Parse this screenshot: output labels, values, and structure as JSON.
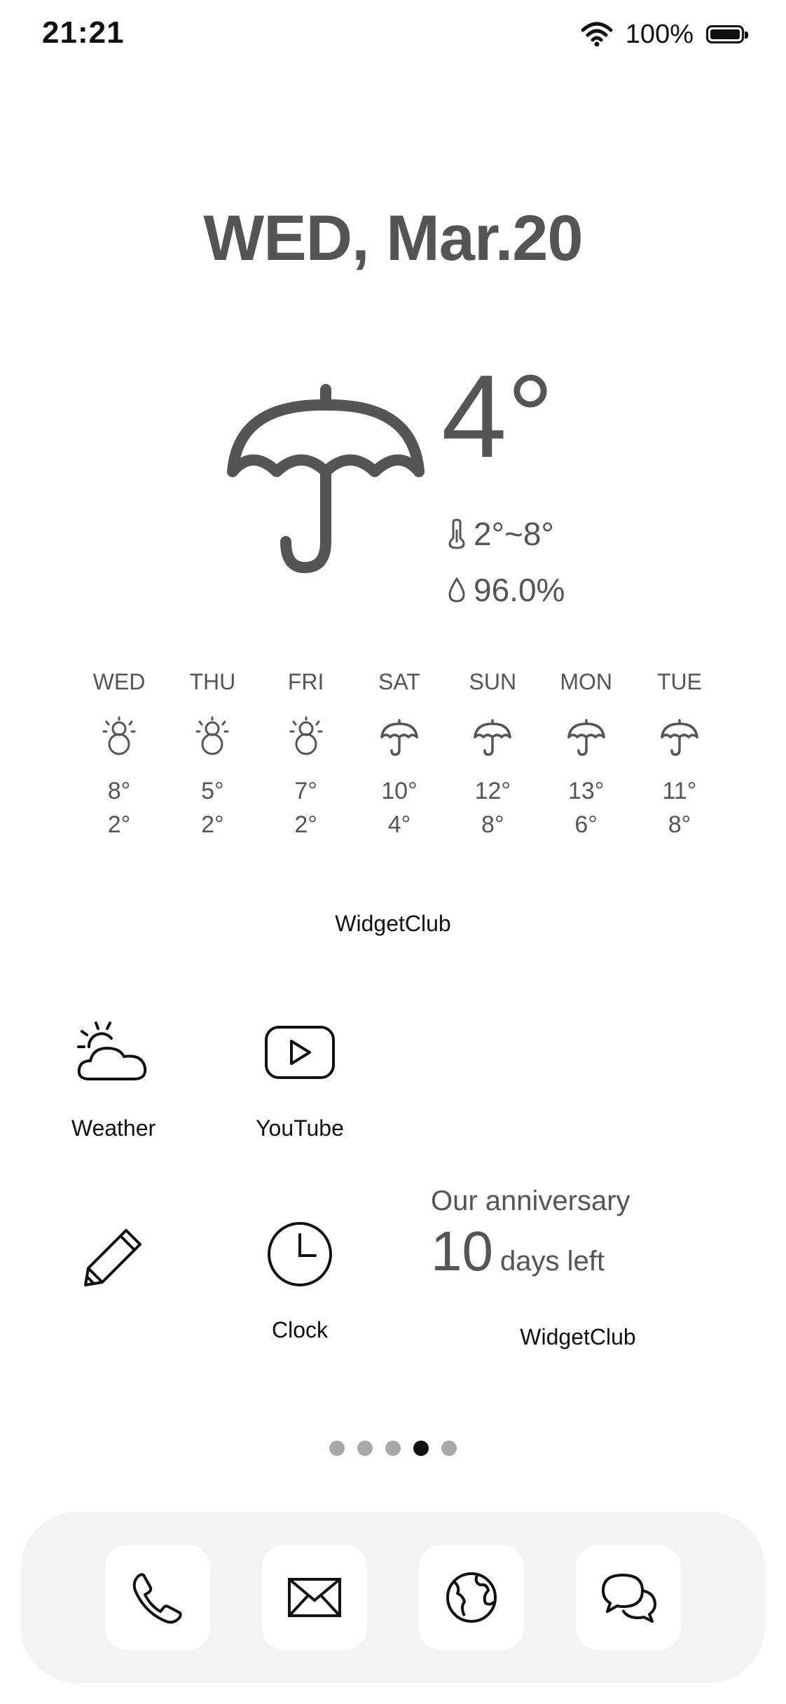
{
  "status_bar": {
    "time": "21:21",
    "battery": "100%",
    "battery_level": 1.0
  },
  "weather_widget": {
    "date": "WED, Mar.20",
    "current_icon": "umbrella-icon",
    "temperature": "4°",
    "min_max": "2°~8°",
    "humidity": "96.0%",
    "forecast": [
      {
        "day": "WED",
        "icon": "snowman-icon",
        "high": "8°",
        "low": "2°"
      },
      {
        "day": "THU",
        "icon": "snowman-icon",
        "high": "5°",
        "low": "2°"
      },
      {
        "day": "FRI",
        "icon": "snowman-icon",
        "high": "7°",
        "low": "2°"
      },
      {
        "day": "SAT",
        "icon": "umbrella-icon",
        "high": "10°",
        "low": "4°"
      },
      {
        "day": "SUN",
        "icon": "umbrella-icon",
        "high": "12°",
        "low": "8°"
      },
      {
        "day": "MON",
        "icon": "umbrella-icon",
        "high": "13°",
        "low": "6°"
      },
      {
        "day": "TUE",
        "icon": "umbrella-icon",
        "high": "11°",
        "low": "8°"
      }
    ],
    "label": "WidgetClub"
  },
  "apps": {
    "weather": {
      "label": "Weather",
      "icon": "sun-cloud-icon"
    },
    "youtube": {
      "label": "YouTube",
      "icon": "play-icon"
    },
    "notes": {
      "label": "",
      "icon": "pencil-icon"
    },
    "clock": {
      "label": "Clock",
      "icon": "clock-icon"
    }
  },
  "anniversary_widget": {
    "title": "Our anniversary",
    "count": "10",
    "unit": "days left",
    "label": "WidgetClub"
  },
  "page_dots": {
    "total": 5,
    "active_index": 3
  },
  "dock": [
    {
      "name": "phone",
      "icon": "phone-icon"
    },
    {
      "name": "mail",
      "icon": "mail-icon"
    },
    {
      "name": "browser",
      "icon": "globe-icon"
    },
    {
      "name": "messages",
      "icon": "chat-icon"
    }
  ]
}
